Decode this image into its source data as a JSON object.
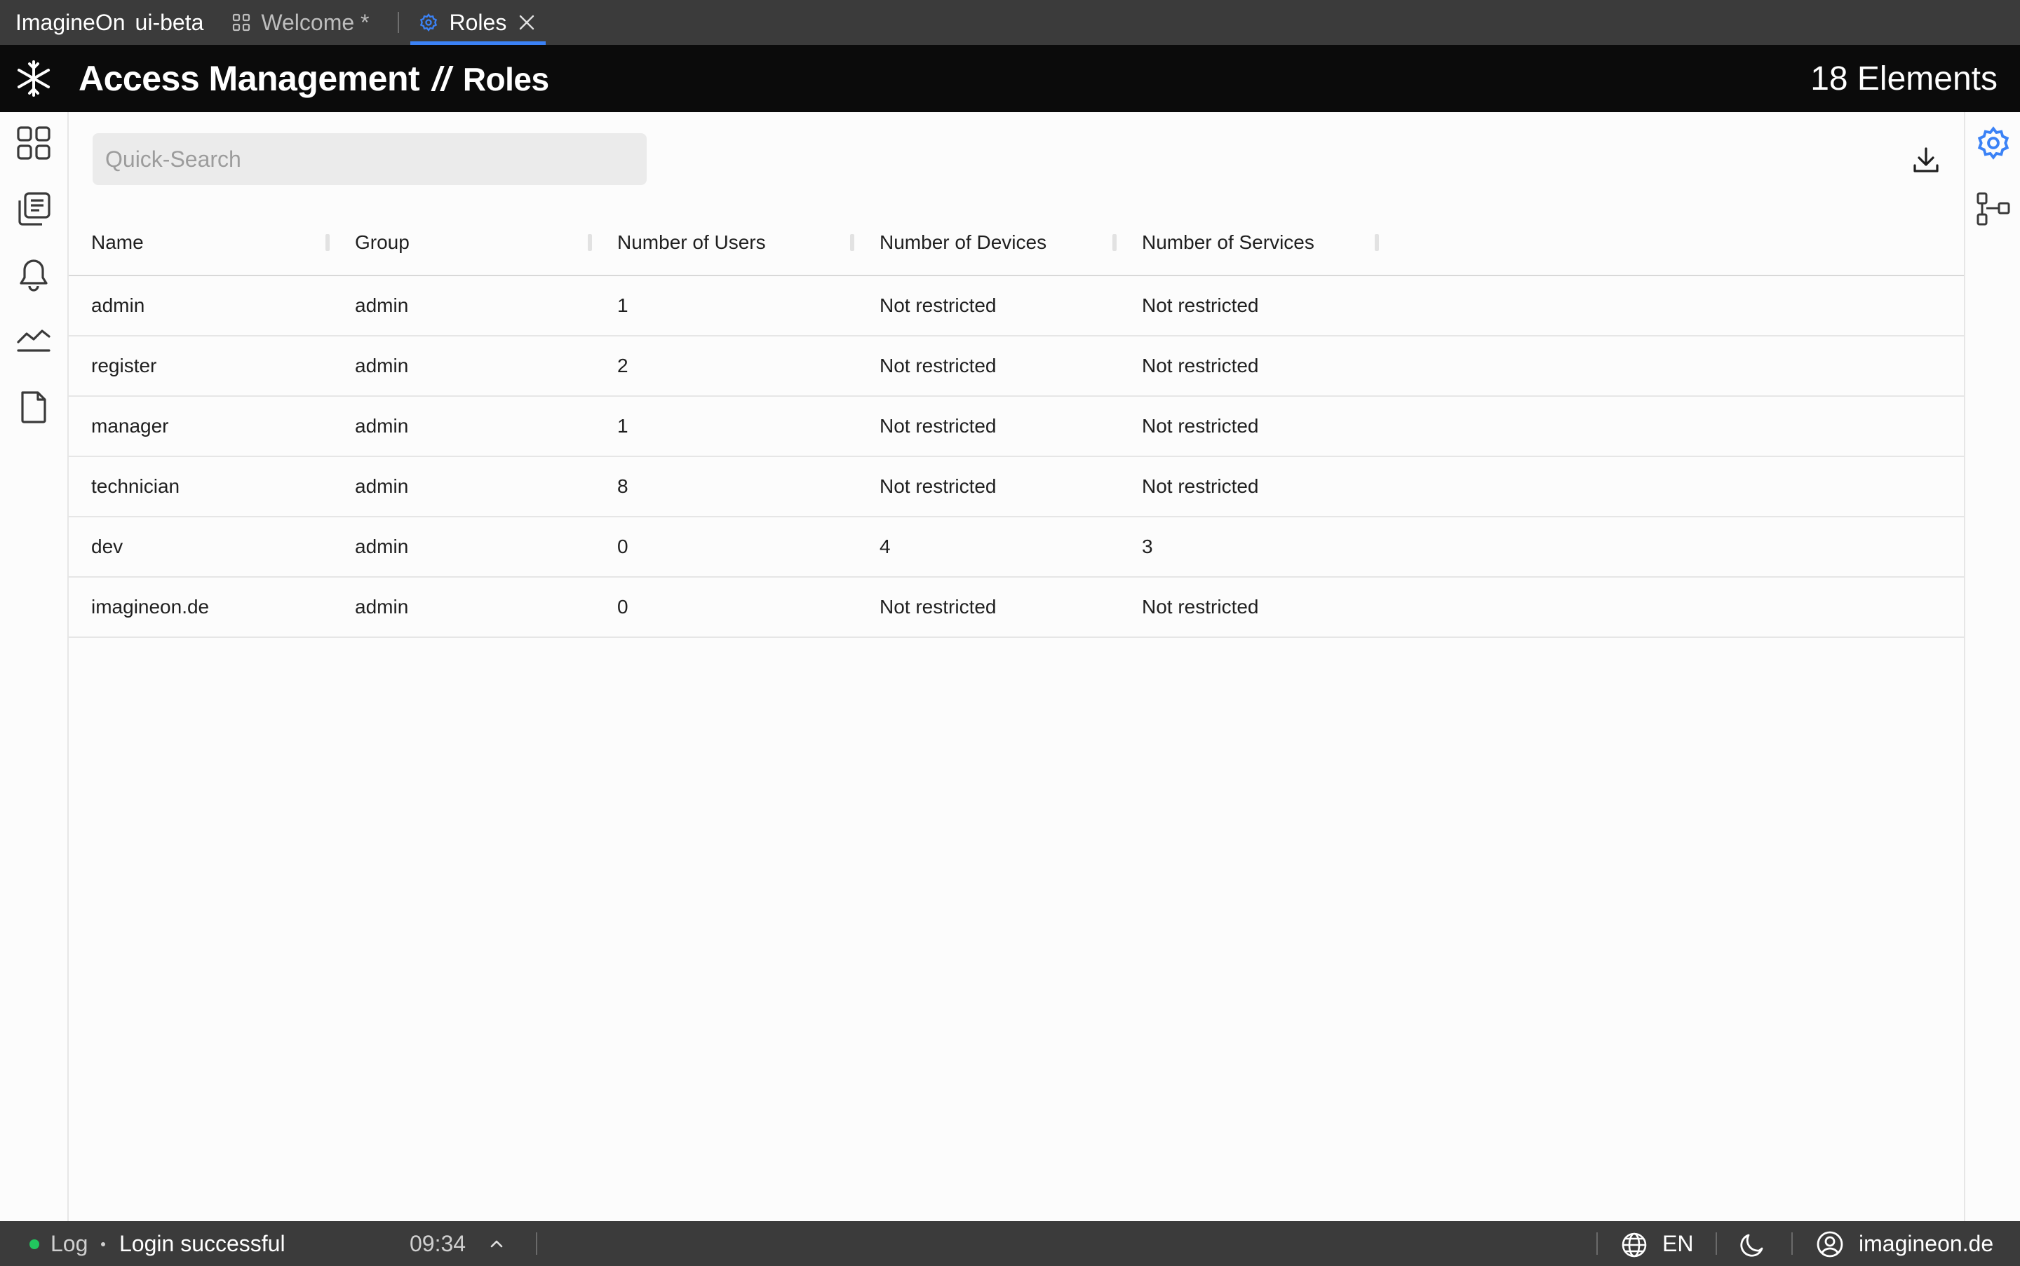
{
  "app": {
    "name": "ImagineOn",
    "env": "ui-beta"
  },
  "tabs": [
    {
      "label": "Welcome *",
      "icon": "grid-icon",
      "active": false
    },
    {
      "label": "Roles",
      "icon": "gear-icon",
      "active": true
    }
  ],
  "header": {
    "title": "Access Management",
    "separator": "//",
    "subtitle": "Roles",
    "count": "18 Elements"
  },
  "search": {
    "placeholder": "Quick-Search",
    "value": ""
  },
  "table": {
    "columns": [
      "Name",
      "Group",
      "Number of Users",
      "Number of Devices",
      "Number of Services"
    ],
    "rows": [
      [
        "admin",
        "admin",
        "1",
        "Not restricted",
        "Not restricted"
      ],
      [
        "register",
        "admin",
        "2",
        "Not restricted",
        "Not restricted"
      ],
      [
        "manager",
        "admin",
        "1",
        "Not restricted",
        "Not restricted"
      ],
      [
        "technician",
        "admin",
        "8",
        "Not restricted",
        "Not restricted"
      ],
      [
        "dev",
        "admin",
        "0",
        "4",
        "3"
      ],
      [
        "imagineon.de",
        "admin",
        "0",
        "Not restricted",
        "Not restricted"
      ]
    ]
  },
  "sidebar_left": [
    "dashboard-icon",
    "documents-icon",
    "bell-icon",
    "chart-icon",
    "file-icon"
  ],
  "sidebar_right": [
    "gear-icon",
    "hierarchy-icon"
  ],
  "statusbar": {
    "log_label": "Log",
    "message": "Login successful",
    "time": "09:34",
    "language": "EN",
    "user": "imagineon.de"
  },
  "colors": {
    "accent": "#3b82f6",
    "status_ok": "#22c55e",
    "header_bg": "#0b0b0b",
    "bar_bg": "#3b3b3b"
  }
}
